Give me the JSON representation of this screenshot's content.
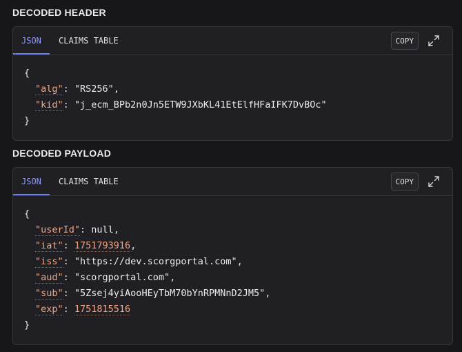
{
  "header_section": {
    "title": "DECODED HEADER",
    "tabs": [
      {
        "label": "JSON",
        "active": true
      },
      {
        "label": "CLAIMS TABLE",
        "active": false
      }
    ],
    "copy_label": "COPY",
    "json": {
      "open": "{",
      "close": "}",
      "fields": [
        {
          "key": "\"alg\"",
          "value": "\"RS256\"",
          "type": "string",
          "comma": ","
        },
        {
          "key": "\"kid\"",
          "value": "\"j_ecm_BPb2n0Jn5ETW9JXbKL41EtElfHFaIFK7DvBOc\"",
          "type": "string",
          "comma": ""
        }
      ]
    }
  },
  "payload_section": {
    "title": "DECODED PAYLOAD",
    "tabs": [
      {
        "label": "JSON",
        "active": true
      },
      {
        "label": "CLAIMS TABLE",
        "active": false
      }
    ],
    "copy_label": "COPY",
    "json": {
      "open": "{",
      "close": "}",
      "fields": [
        {
          "key": "\"userId\"",
          "value": "null",
          "type": "literal",
          "comma": ","
        },
        {
          "key": "\"iat\"",
          "value": "1751793916",
          "type": "number",
          "comma": ","
        },
        {
          "key": "\"iss\"",
          "value": "\"https://dev.scorgportal.com\"",
          "type": "string",
          "comma": ","
        },
        {
          "key": "\"aud\"",
          "value": "\"scorgportal.com\"",
          "type": "string",
          "comma": ","
        },
        {
          "key": "\"sub\"",
          "value": "\"5Zsej4yiAooHEyTbM70bYnRPMNnD2JM5\"",
          "type": "string",
          "comma": ","
        },
        {
          "key": "\"exp\"",
          "value": "1751815516",
          "type": "number",
          "comma": ""
        }
      ]
    }
  },
  "colors": {
    "background": "#17171a",
    "panel": "#202024",
    "accent_tab": "#8c9cf7",
    "json_key": "#f1a582"
  },
  "icons": {
    "expand": "expand-arrows-icon"
  }
}
